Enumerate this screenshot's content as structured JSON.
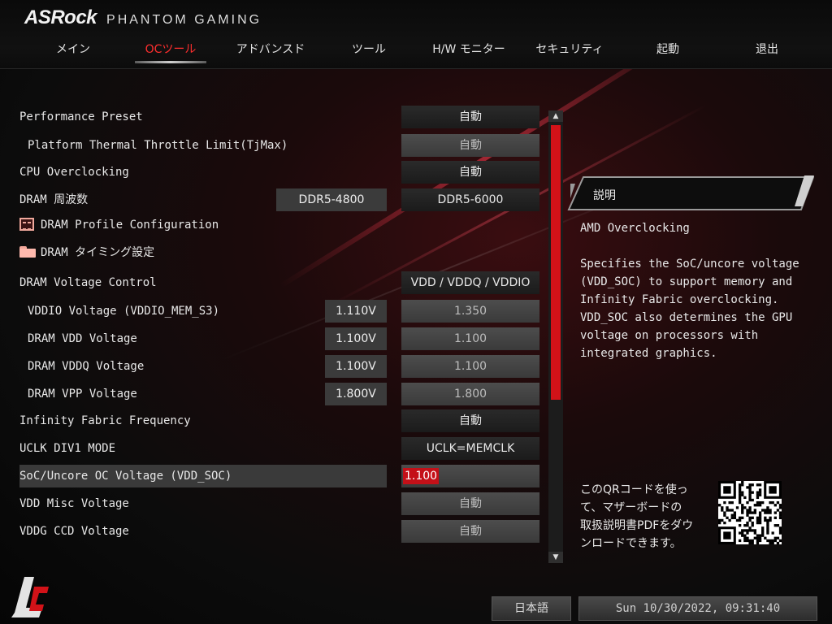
{
  "header": {
    "brand": "ASRock",
    "sub": "PHANTOM GAMING"
  },
  "tabs": [
    {
      "label": "メイン"
    },
    {
      "label": "OCツール"
    },
    {
      "label": "アドバンスド"
    },
    {
      "label": "ツール"
    },
    {
      "label": "H/W モニター"
    },
    {
      "label": "セキュリティ"
    },
    {
      "label": "起動"
    },
    {
      "label": "退出"
    }
  ],
  "active_tab": "OCツール",
  "settings": {
    "performance_preset": {
      "label": "Performance Preset",
      "value": "自動"
    },
    "platform_thermal": {
      "label": "Platform Thermal Throttle Limit(TjMax)",
      "value": "自動"
    },
    "cpu_overclocking": {
      "label": "CPU Overclocking",
      "value": "自動"
    },
    "dram_freq": {
      "label": "DRAM 周波数",
      "current": "DDR5-4800",
      "value": "DDR5-6000"
    },
    "dram_profile": {
      "label": "DRAM Profile Configuration"
    },
    "dram_timing": {
      "label": "DRAM タイミング設定"
    },
    "dram_voltage_control": {
      "label": "DRAM Voltage Control",
      "value": "VDD / VDDQ / VDDIO"
    },
    "vddio": {
      "label": "VDDIO Voltage (VDDIO_MEM_S3)",
      "current": "1.110V",
      "value": "1.350"
    },
    "dram_vdd": {
      "label": "DRAM VDD Voltage",
      "current": "1.100V",
      "value": "1.100"
    },
    "dram_vddq": {
      "label": "DRAM VDDQ Voltage",
      "current": "1.100V",
      "value": "1.100"
    },
    "dram_vpp": {
      "label": "DRAM VPP Voltage",
      "current": "1.800V",
      "value": "1.800"
    },
    "infinity_fabric": {
      "label": "Infinity Fabric Frequency",
      "value": "自動"
    },
    "uclk_div1": {
      "label": "UCLK DIV1 MODE",
      "value": "UCLK=MEMCLK"
    },
    "soc_voltage": {
      "label": "SoC/Uncore OC Voltage (VDD_SOC)",
      "value": "1.100"
    },
    "vdd_misc": {
      "label": "VDD Misc Voltage",
      "value": "自動"
    },
    "vddg_ccd": {
      "label": "VDDG CCD Voltage",
      "value": "自動"
    }
  },
  "description": {
    "title": "説明",
    "heading": "AMD Overclocking",
    "lines": [
      "Specifies the SoC/uncore voltage",
      "(VDD_SOC) to support memory and",
      "Infinity Fabric overclocking.",
      "VDD_SOC also determines the GPU",
      "voltage on processors with",
      "integrated graphics."
    ]
  },
  "qr_text": [
    "このQRコードを使っ",
    "て、マザーボードの",
    "取扱説明書PDFをダウ",
    "ンロードできます。"
  ],
  "footer": {
    "language": "日本語",
    "datetime": "Sun 10/30/2022, 09:31:40"
  },
  "colors": {
    "accent": "#d21218",
    "active_tab": "#ff2e2e"
  }
}
